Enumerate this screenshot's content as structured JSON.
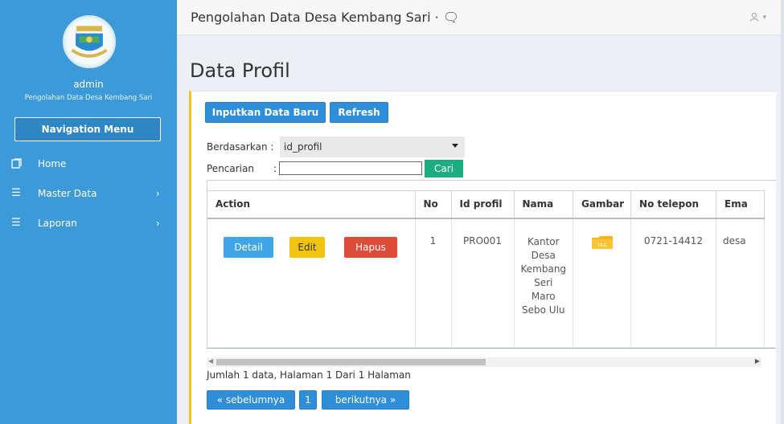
{
  "sidebar": {
    "user": "admin",
    "subtitle": "Pengolahan Data Desa Kembang Sari",
    "nav_button": "Navigation Menu",
    "items": [
      {
        "label": "Home",
        "icon": "home-icon"
      },
      {
        "label": "Master Data",
        "icon": "list-icon"
      },
      {
        "label": "Laporan",
        "icon": "list-icon"
      }
    ]
  },
  "topbar": {
    "title": "Pengolahan Data Desa Kembang Sari · 🗨",
    "user_icon": "user-icon"
  },
  "page": {
    "title": "Data Profil"
  },
  "toolbar": {
    "new_label": "Inputkan Data Baru",
    "refresh_label": "Refresh"
  },
  "filter": {
    "by_label": "Berdasarkan :",
    "by_value": "id_profil",
    "search_label": "Pencarian",
    "search_sep": ":",
    "search_value": "",
    "search_button": "Cari"
  },
  "table": {
    "headers": [
      "Action",
      "No",
      "Id profil",
      "Nama",
      "Gambar",
      "No telepon",
      "Ema"
    ],
    "rows": [
      {
        "no": "1",
        "id": "PRO001",
        "nama": "Kantor Desa Kembang Seri Maro Sebo Ulu",
        "gambar_icon": "folder-icon",
        "telepon": "0721-14412",
        "email": "desa",
        "actions": {
          "detail": "Detail",
          "edit": "Edit",
          "hapus": "Hapus"
        }
      }
    ]
  },
  "summary": "Jumlah 1 data, Halaman 1 Dari 1 Halaman",
  "pagination": {
    "prev": "« sebelumnya",
    "page": "1",
    "next": "berikutnya »"
  },
  "colors": {
    "sidebar": "#3c9ad8",
    "primary": "#2f8ed8",
    "success": "#1cae81",
    "warning": "#f2c412",
    "danger": "#dd4b39",
    "panel_accent": "#f5c518"
  }
}
